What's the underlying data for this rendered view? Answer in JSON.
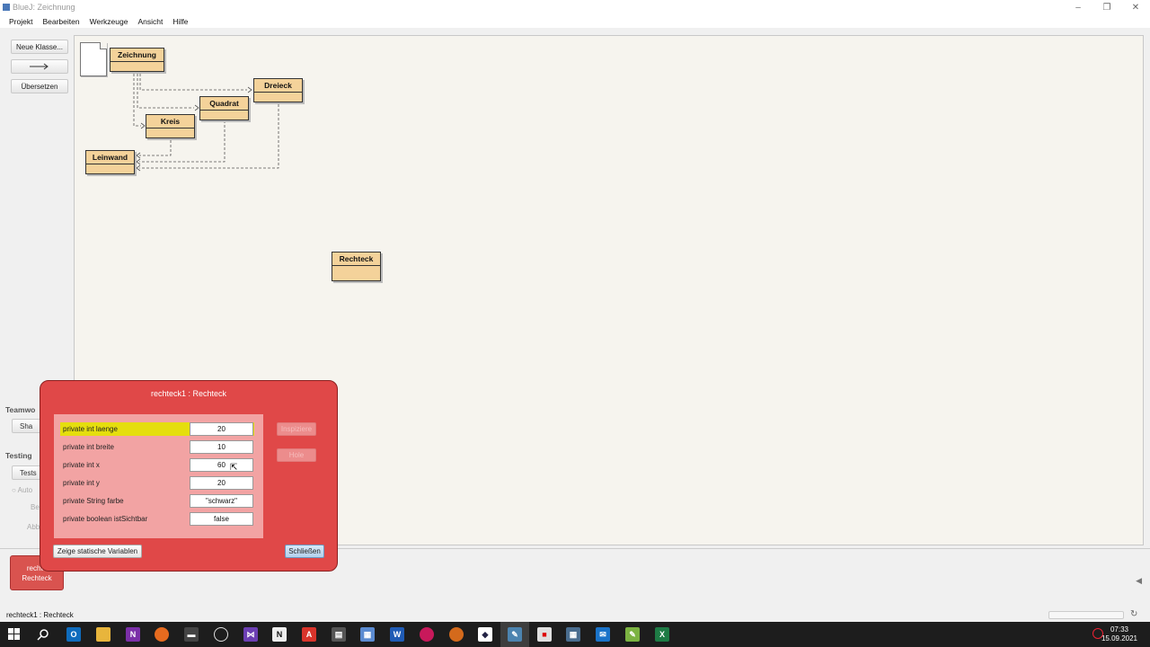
{
  "window": {
    "title": "BlueJ: Zeichnung",
    "controls": {
      "minimize": "–",
      "maximize": "❐",
      "close": "✕"
    }
  },
  "menu": [
    "Projekt",
    "Bearbeiten",
    "Werkzeuge",
    "Ansicht",
    "Hilfe"
  ],
  "sidebar": {
    "new_class": "Neue Klasse...",
    "arrow": "→",
    "compile": "Übersetzen",
    "teamwork_label": "Teamwo",
    "share_label": "Sha",
    "testing_label": "Testing",
    "run_tests_label": "Tests",
    "autotest_label": "Auto",
    "be_label": "Be",
    "abb_label": "Abb"
  },
  "diagram": {
    "classes": [
      "Zeichnung",
      "Dreieck",
      "Quadrat",
      "Kreis",
      "Leinwand",
      "Rechteck"
    ],
    "class_color": "#f4d29a"
  },
  "object_bench": {
    "object_line1": "rechte",
    "object_line2": "Rechteck",
    "object_color": "#d9534f"
  },
  "inspector": {
    "title": "rechteck1 : Rechteck",
    "fields": [
      {
        "label": "private int laenge",
        "value": "20",
        "selected": true
      },
      {
        "label": "private int breite",
        "value": "10"
      },
      {
        "label": "private int x",
        "value": "60"
      },
      {
        "label": "private int y",
        "value": "20"
      },
      {
        "label": "private String farbe",
        "value": "\"schwarz\""
      },
      {
        "label": "private boolean istSichtbar",
        "value": "false"
      }
    ],
    "inspect_button": "Inspiziere",
    "get_button": "Hole",
    "static_button": "Zeige statische Variablen",
    "close_button": "Schließen",
    "background_color": "#e04848"
  },
  "status": {
    "text": "rechteck1 : Rechteck"
  },
  "taskbar": {
    "time": "07:33",
    "date": "15.09.2021",
    "apps": [
      "windows-icon",
      "search-icon",
      "outlook-icon",
      "explorer-icon",
      "onenote-icon",
      "firefox-icon",
      "terminal-icon",
      "obs-icon",
      "visualstudio-icon",
      "notepad-icon",
      "acrobat-icon",
      "calculator-icon",
      "photos-icon",
      "word-icon",
      "raspberry-icon",
      "app-icon",
      "inkscape-icon",
      "bluej-icon",
      "camera-icon",
      "calculator2-icon",
      "mail-icon",
      "notepadpp-icon",
      "excel-icon"
    ]
  }
}
